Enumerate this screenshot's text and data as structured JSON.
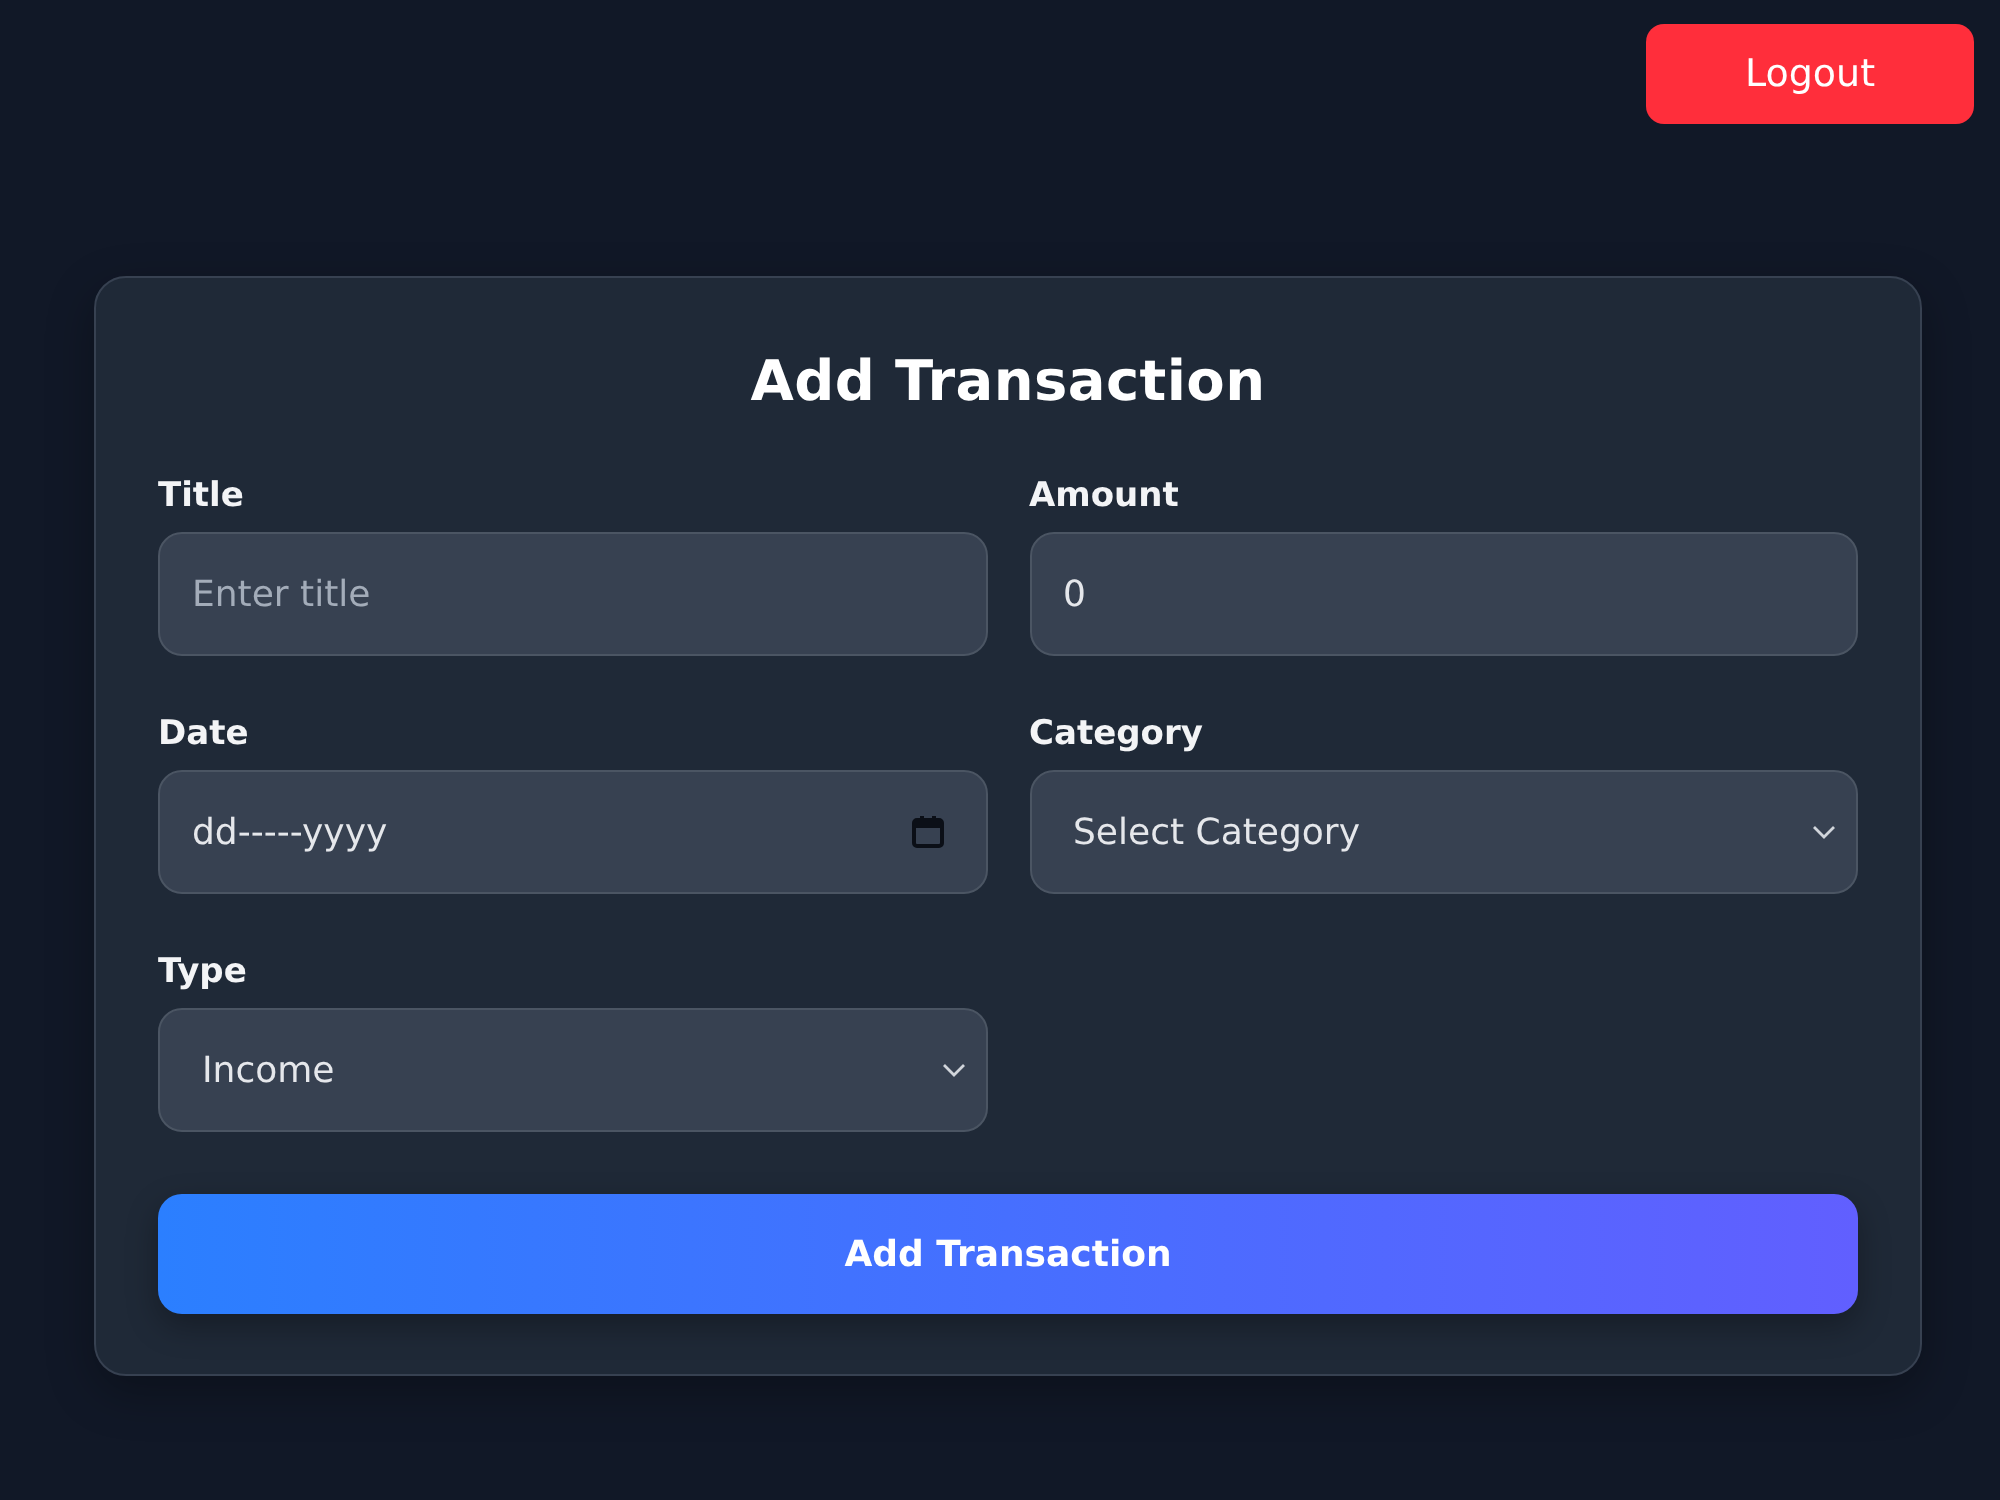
{
  "header": {
    "logout_button": "Logout"
  },
  "form": {
    "title": "Add Transaction",
    "fields": [
      {
        "kind": "text",
        "label": "Title",
        "placeholder": "Enter title"
      },
      {
        "kind": "number",
        "label": "Amount",
        "value": "0"
      },
      {
        "kind": "date",
        "label": "Date",
        "value": "dd-----yyyy"
      },
      {
        "kind": "select",
        "label": "Category",
        "value": "Select Category"
      },
      {
        "kind": "select",
        "label": "Type",
        "value": "Income"
      }
    ],
    "submit_button": "Add Transaction"
  }
}
